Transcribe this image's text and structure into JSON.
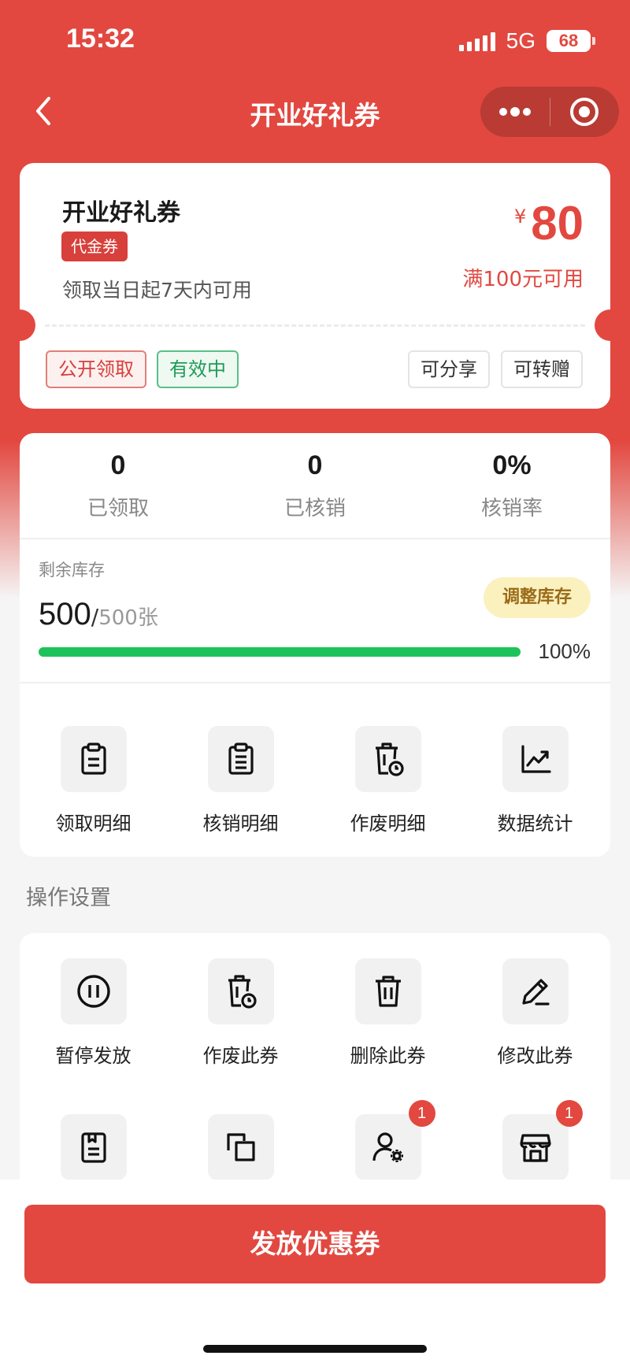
{
  "status_bar": {
    "time": "15:32",
    "network": "5G",
    "battery": "68"
  },
  "nav": {
    "title": "开业好礼券",
    "back_icon": "chevron-left-icon",
    "more_icon": "more-dots-icon",
    "close_icon": "target-icon"
  },
  "coupon": {
    "name": "开业好礼券",
    "type": "代金券",
    "validity": "领取当日起7天内可用",
    "currency": "¥",
    "amount": "80",
    "condition": "满100元可用",
    "tags": {
      "public": "公开领取",
      "status": "有效中",
      "share": "可分享",
      "gift": "可转赠"
    }
  },
  "stats": [
    {
      "value": "0",
      "label": "已领取"
    },
    {
      "value": "0",
      "label": "已核销"
    },
    {
      "value": "0%",
      "label": "核销率"
    }
  ],
  "stock": {
    "label": "剩余库存",
    "current": "500",
    "slash": "/",
    "total": "500张",
    "adjust": "调整库存",
    "percent_text": "100%",
    "fraction": 1.0
  },
  "detail_actions": [
    {
      "label": "领取明细",
      "icon": "clipboard-icon"
    },
    {
      "label": "核销明细",
      "icon": "list-document-icon"
    },
    {
      "label": "作废明细",
      "icon": "trash-clock-icon"
    },
    {
      "label": "数据统计",
      "icon": "trend-chart-icon"
    }
  ],
  "ops_section_title": "操作设置",
  "ops_actions": [
    {
      "label": "暂停发放",
      "icon": "pause-circle-icon"
    },
    {
      "label": "作废此券",
      "icon": "trash-clock-icon"
    },
    {
      "label": "删除此券",
      "icon": "trash-icon"
    },
    {
      "label": "修改此券",
      "icon": "pencil-icon"
    }
  ],
  "ops_actions_row2": [
    {
      "icon": "bookmark-document-icon",
      "badge": ""
    },
    {
      "icon": "copy-icon",
      "badge": ""
    },
    {
      "icon": "user-settings-icon",
      "badge": "1"
    },
    {
      "icon": "store-icon",
      "badge": "1"
    }
  ],
  "primary_button": "发放优惠券",
  "colors": {
    "brand_red": "#e24840",
    "success_green": "#1dc35a",
    "adjust_bg": "#fbf1bf"
  }
}
